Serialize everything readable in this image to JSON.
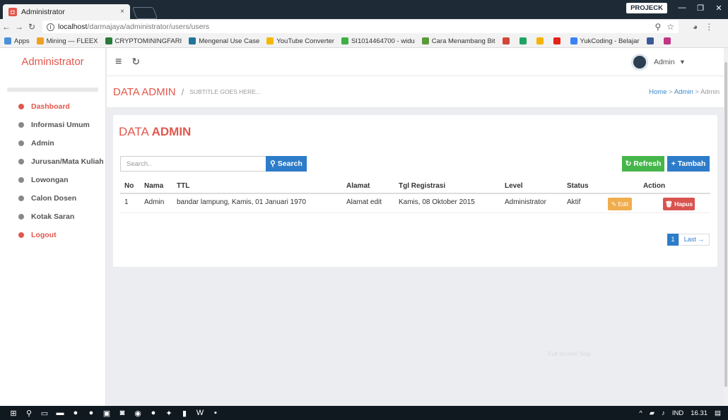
{
  "browser": {
    "tab_title": "Administrator",
    "tab_close": "×",
    "profile": "PROJECK",
    "url_host": "localhost",
    "url_path": "/darmajaya/administrator/users/users",
    "bookmarks": [
      {
        "label": "Apps",
        "color": "#4a90d9"
      },
      {
        "label": "Mining — FLEEX",
        "color": "#f0a020"
      },
      {
        "label": "CRYPTOMININGFARI",
        "color": "#2a7a3a"
      },
      {
        "label": "Mengenal Use Case",
        "color": "#21759b"
      },
      {
        "label": "YouTube Converter",
        "color": "#f5b700"
      },
      {
        "label": "SI1014464700 - widu",
        "color": "#3cb043"
      },
      {
        "label": "Cara Menambang Bit",
        "color": "#5a9a3a"
      },
      {
        "label": "",
        "color": "#d44638"
      },
      {
        "label": "",
        "color": "#1fa463"
      },
      {
        "label": "",
        "color": "#f4b400"
      },
      {
        "label": "",
        "color": "#e62117"
      },
      {
        "label": "YukCoding - Belajar",
        "color": "#3b82f6"
      },
      {
        "label": "",
        "color": "#3b5998"
      },
      {
        "label": "",
        "color": "#c13584"
      }
    ]
  },
  "sidebar": {
    "brand": "Administrator",
    "items": [
      {
        "label": "Dashboard",
        "state": "active"
      },
      {
        "label": "Informasi Umum",
        "state": "normal"
      },
      {
        "label": "Admin",
        "state": "normal"
      },
      {
        "label": "Jurusan/Mata Kuliah",
        "state": "normal"
      },
      {
        "label": "Lowongan",
        "state": "normal"
      },
      {
        "label": "Calon Dosen",
        "state": "normal"
      },
      {
        "label": "Kotak Saran",
        "state": "normal"
      },
      {
        "label": "Logout",
        "state": "logout"
      }
    ]
  },
  "topnav": {
    "user": "Admin"
  },
  "header": {
    "title": "DATA ADMIN",
    "subtitle": "SUBTITLE GOES HERE...",
    "breadcrumb": [
      "Home",
      "Admin",
      "Admin"
    ]
  },
  "card": {
    "title_plain": "DATA ",
    "title_bold": "ADMIN",
    "search_placeholder": "Search..",
    "search_button": "Search",
    "refresh_button": "Refresh",
    "add_button": "Tambah",
    "columns": [
      "No",
      "Nama",
      "TTL",
      "Alamat",
      "Tgl Registrasi",
      "Level",
      "Status",
      "Action"
    ],
    "rows": [
      {
        "no": "1",
        "nama": "Admin",
        "ttl": "bandar lampung, Kamis, 01 Januari 1970",
        "alamat": "Alamat edit",
        "tgl": "Kamis, 08 Oktober 2015",
        "level": "Administrator",
        "status": "Aktif",
        "edit": "Edit",
        "hapus": "Hapus"
      }
    ],
    "pager_current": "1",
    "pager_last": "Last →"
  },
  "overlay": {
    "snip": "Full-screen Snip"
  },
  "taskbar": {
    "lang": "IND",
    "time": "16.31"
  }
}
